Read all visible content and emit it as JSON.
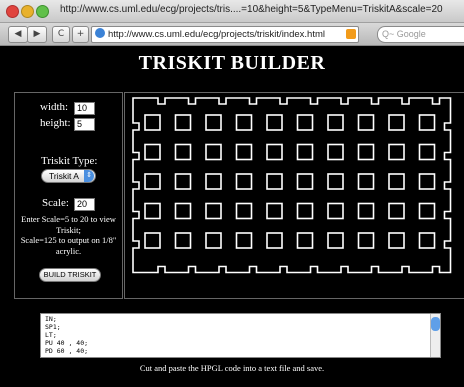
{
  "window": {
    "title": "http://www.cs.uml.edu/ecg/projects/tris....=10&height=5&TypeMenu=TriskitA&scale=20"
  },
  "toolbar": {
    "back_label": "◀",
    "forward_label": "▶",
    "reload_label": "C",
    "add_label": "+",
    "url": "http://www.cs.uml.edu/ecg/projects/triskit/index.html",
    "search_placeholder": "Q~ Google"
  },
  "page": {
    "title": "TRISKIT BUILDER",
    "form": {
      "width_label": "width:",
      "width_value": "10",
      "height_label": "height:",
      "height_value": "5",
      "type_label": "Triskit Type:",
      "type_value": "Triskit A",
      "scale_label": "Scale:",
      "scale_value": "20",
      "note_line1": "Enter Scale=5 to 20 to view",
      "note_line2": "Triskit;",
      "note_line3": "Scale=125 to output on 1/8\"",
      "note_line4": "acrylic.",
      "build_button": "BUILD TRISKIT"
    },
    "preview": {
      "cols": 10,
      "rows": 5
    },
    "code_lines": [
      "IN;",
      "SP1;",
      "LT;",
      "PU 40 , 40;",
      "PD 60 , 40;"
    ],
    "caption": "Cut and paste the HPGL code into a text file and save."
  }
}
